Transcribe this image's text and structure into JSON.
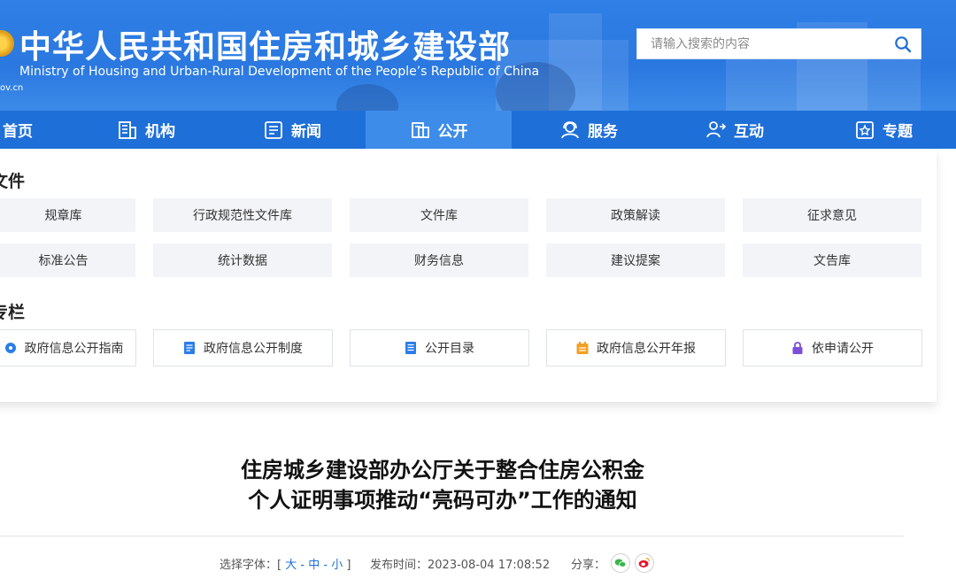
{
  "header": {
    "title_cn": "中华人民共和国住房和城乡建设部",
    "title_en": "Ministry of Housing and Urban-Rural Development of the People’s Republic of China",
    "domain_fragment": "ov.cn",
    "search_placeholder": "请输入搜索的内容"
  },
  "nav": {
    "items": [
      {
        "label": "首页",
        "icon": "home-icon"
      },
      {
        "label": "机构",
        "icon": "building-icon"
      },
      {
        "label": "新闻",
        "icon": "news-icon"
      },
      {
        "label": "公开",
        "icon": "disclosure-icon",
        "active": true
      },
      {
        "label": "服务",
        "icon": "service-icon"
      },
      {
        "label": "互动",
        "icon": "interaction-icon"
      },
      {
        "label": "专题",
        "icon": "topic-icon"
      }
    ]
  },
  "files_section": {
    "title": "文件",
    "row1": [
      "规章库",
      "行政规范性文件库",
      "文件库",
      "政策解读",
      "征求意见"
    ],
    "row2": [
      "标准公告",
      "统计数据",
      "财务信息",
      "建议提案",
      "文告库"
    ]
  },
  "column_section": {
    "title": "专栏",
    "items": [
      {
        "label": "政府信息公开指南",
        "icon": "guide-icon",
        "color": "#2b7de9"
      },
      {
        "label": "政府信息公开制度",
        "icon": "document-icon",
        "color": "#2b7de9"
      },
      {
        "label": "公开目录",
        "icon": "catalog-icon",
        "color": "#2b7de9"
      },
      {
        "label": "政府信息公开年报",
        "icon": "calendar-icon",
        "color": "#f2a024"
      },
      {
        "label": "依申请公开",
        "icon": "lock-icon",
        "color": "#7b4fd8"
      }
    ]
  },
  "article": {
    "title_line1": "住房城乡建设部办公厅关于整合住房公积金",
    "title_line2": "个人证明事项推动“亮码可办”工作的通知",
    "font_size_label": "选择字体：",
    "bracket_open": "[",
    "size_large": "大",
    "sep1": "-",
    "size_medium": "中",
    "sep2": "-",
    "size_small": "小",
    "bracket_close": "]",
    "publish_label": "发布时间：",
    "publish_time": "2023-08-04 17:08:52",
    "share_label": "分享："
  },
  "colors": {
    "nav_bg": "#1f6fd8",
    "nav_active": "#3e8ce9",
    "banner": "#2a78e0",
    "link": "#1f6fd8"
  }
}
